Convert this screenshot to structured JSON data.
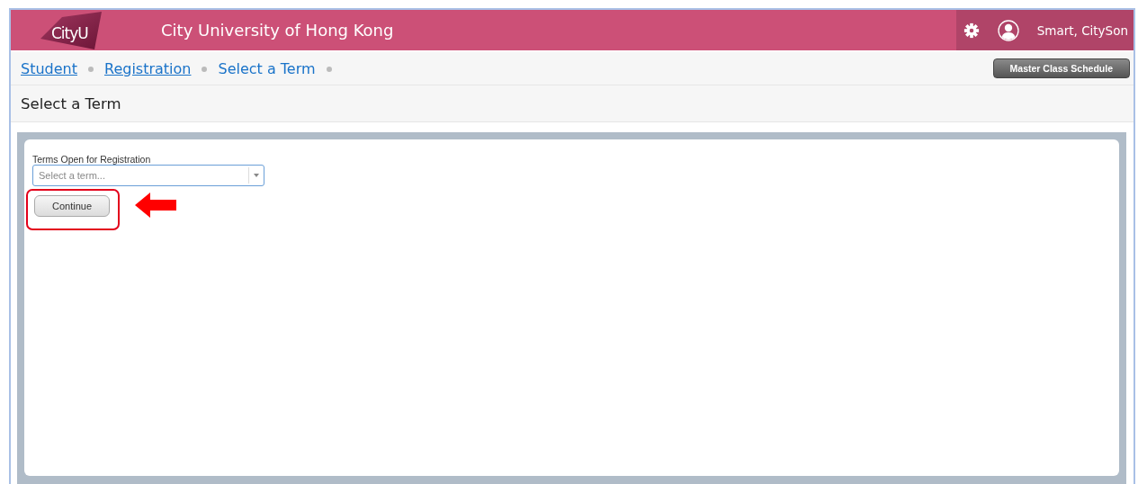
{
  "header": {
    "logo": "CityU",
    "title": "City University of Hong Kong",
    "user": "Smart, CitySon"
  },
  "breadcrumbs": [
    {
      "label": "Student",
      "link": true
    },
    {
      "label": "Registration",
      "link": true
    },
    {
      "label": "Select a Term",
      "link": false
    }
  ],
  "toolbar": {
    "button": "Master Class Schedule"
  },
  "page_title": "Select a Term",
  "form": {
    "label": "Terms Open for Registration",
    "placeholder": "Select a term...",
    "button": "Continue",
    "highlighted": true
  }
}
